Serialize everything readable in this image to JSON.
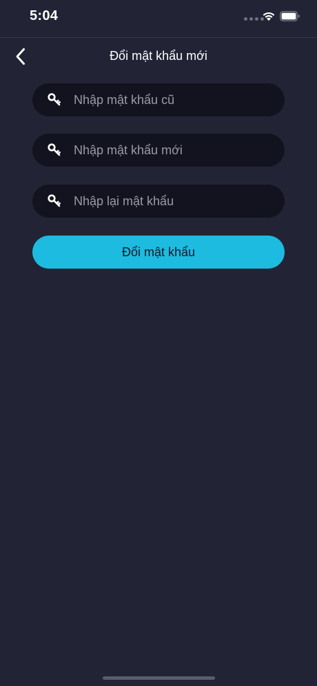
{
  "status_bar": {
    "time": "5:04"
  },
  "nav": {
    "back_icon": "chevron-left-icon",
    "title": "Đổi mật khẩu mới"
  },
  "form": {
    "old_password": {
      "icon": "key-icon",
      "value": "",
      "placeholder": "Nhập mật khẩu cũ"
    },
    "new_password": {
      "icon": "key-icon",
      "value": "",
      "placeholder": "Nhập mật khẩu mới"
    },
    "confirm_password": {
      "icon": "key-icon",
      "value": "",
      "placeholder": "Nhập lại mật khẩu"
    },
    "submit_label": "Đổi mật khẩu"
  },
  "colors": {
    "background": "#222335",
    "field_background": "#131320",
    "accent": "#1dbbe0",
    "placeholder": "#9a9aa8"
  }
}
